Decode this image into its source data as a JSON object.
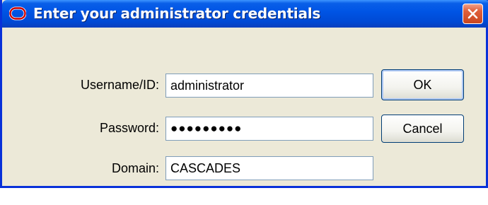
{
  "dialog": {
    "title": "Enter your administrator credentials",
    "icon": "oracle-logo-icon",
    "accent_color": "#cc0000"
  },
  "form": {
    "username": {
      "label": "Username/ID:",
      "value": "administrator"
    },
    "password": {
      "label": "Password:",
      "value": "●●●●●●●●●"
    },
    "domain": {
      "label": "Domain:",
      "value": "CASCADES"
    }
  },
  "buttons": {
    "ok_label": "OK",
    "cancel_label": "Cancel"
  },
  "colors": {
    "titlebar": "#0055e5",
    "window_frame": "#0831d9",
    "dialog_bg": "#ece9d8",
    "close_button": "#e0603c"
  }
}
